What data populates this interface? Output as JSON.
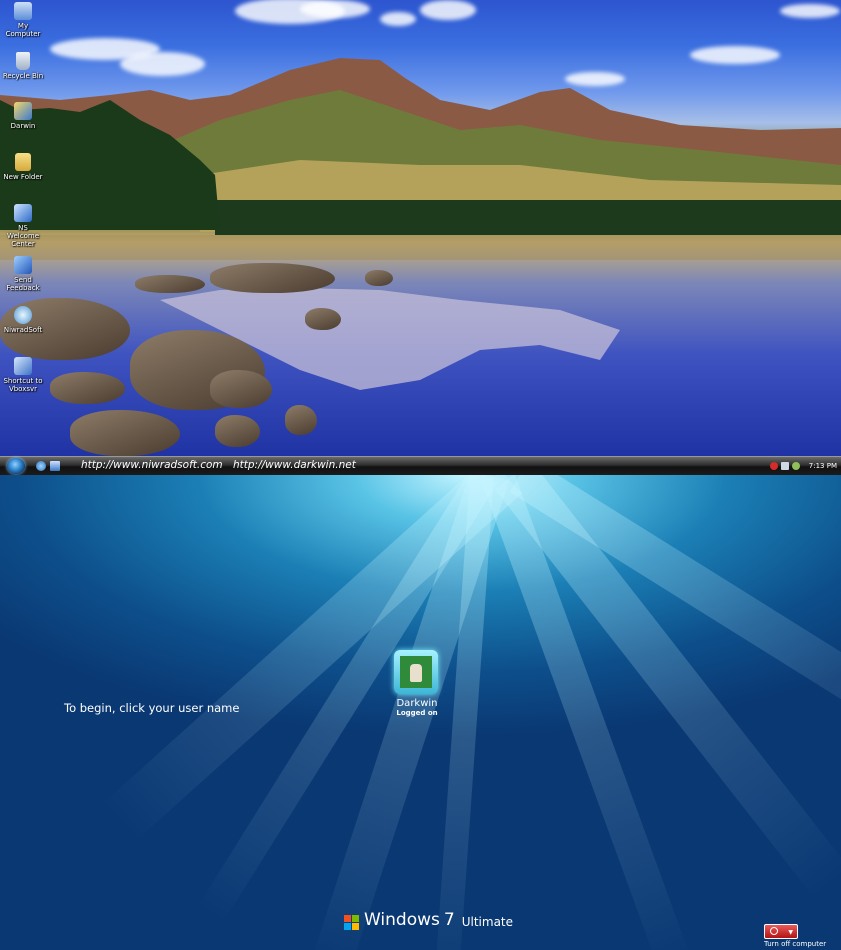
{
  "desktop": {
    "icons": [
      {
        "label": "My Computer",
        "icon": "computer-icon",
        "color": "#5b8fd8"
      },
      {
        "label": "Recycle Bin",
        "icon": "recycle-bin-icon",
        "color": "#c9d6e6"
      },
      {
        "label": "Darwin",
        "icon": "program-shortcut-icon",
        "color": "#e3c34a"
      },
      {
        "label": "New Folder",
        "icon": "folder-icon",
        "color": "#e6c55a"
      },
      {
        "label": "NS Welcome Center",
        "icon": "welcome-center-icon",
        "color": "#3a7bd5"
      },
      {
        "label": "Send Feedback",
        "icon": "feedback-icon",
        "color": "#2f6fd0"
      },
      {
        "label": "NiwradSoft",
        "icon": "niwradsoft-icon",
        "color": "#5fa8d8"
      },
      {
        "label": "Shortcut to Vboxsvr",
        "icon": "network-shortcut-icon",
        "color": "#4b84d6"
      }
    ]
  },
  "taskbar": {
    "link1": "http://www.niwradsoft.com",
    "link2": "http://www.darkwin.net",
    "clock": "7:13 PM"
  },
  "logon": {
    "instruction": "To begin, click your user name",
    "user": {
      "name": "Darkwin",
      "status": "Logged on"
    },
    "brand": {
      "windows": "Windows",
      "version": "7",
      "edition": "Ultimate"
    },
    "power_label": "Turn off computer"
  }
}
